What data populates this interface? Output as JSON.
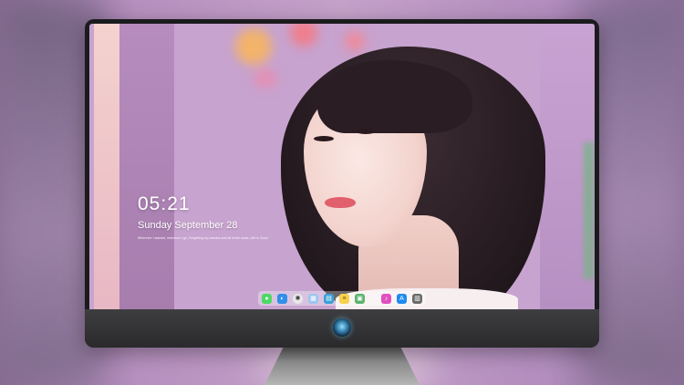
{
  "lockscreen": {
    "time": "05:21",
    "date": "Sunday September  28",
    "quote": "Wherever I wander, wherever I go, Forgetting my worries and all of the woes, Life is Good"
  },
  "dock": {
    "apps": [
      {
        "name": "messages",
        "icon": "speech-bubble-icon",
        "glyph": "●",
        "color": "#4cd964"
      },
      {
        "name": "finder",
        "icon": "finder-icon",
        "glyph": "◐",
        "color": "#2f8fea"
      },
      {
        "name": "safari",
        "icon": "compass-icon",
        "glyph": "✺",
        "color": "#e8e8e8"
      },
      {
        "name": "preview",
        "icon": "photo-icon",
        "glyph": "▦",
        "color": "#9ec5f0"
      },
      {
        "name": "videos",
        "icon": "clapperboard-icon",
        "glyph": "▤",
        "color": "#3aa0d8"
      },
      {
        "name": "notes",
        "icon": "note-icon",
        "glyph": "≡",
        "color": "#f7d24a"
      },
      {
        "name": "photos",
        "icon": "gallery-icon",
        "glyph": "▣",
        "color": "#5ab36e"
      },
      {
        "name": "music",
        "icon": "music-note-icon",
        "glyph": "♪",
        "color": "#e04fc0"
      },
      {
        "name": "app-store",
        "icon": "app-store-icon",
        "glyph": "A",
        "color": "#1e8cf0"
      },
      {
        "name": "trash",
        "icon": "trash-icon",
        "glyph": "▥",
        "color": "#6b6b6b"
      }
    ]
  },
  "colors": {
    "bezel": "#1b1b1d",
    "wallpaper": "#c7a3cf",
    "logo_glow": "#8fe0ff"
  }
}
